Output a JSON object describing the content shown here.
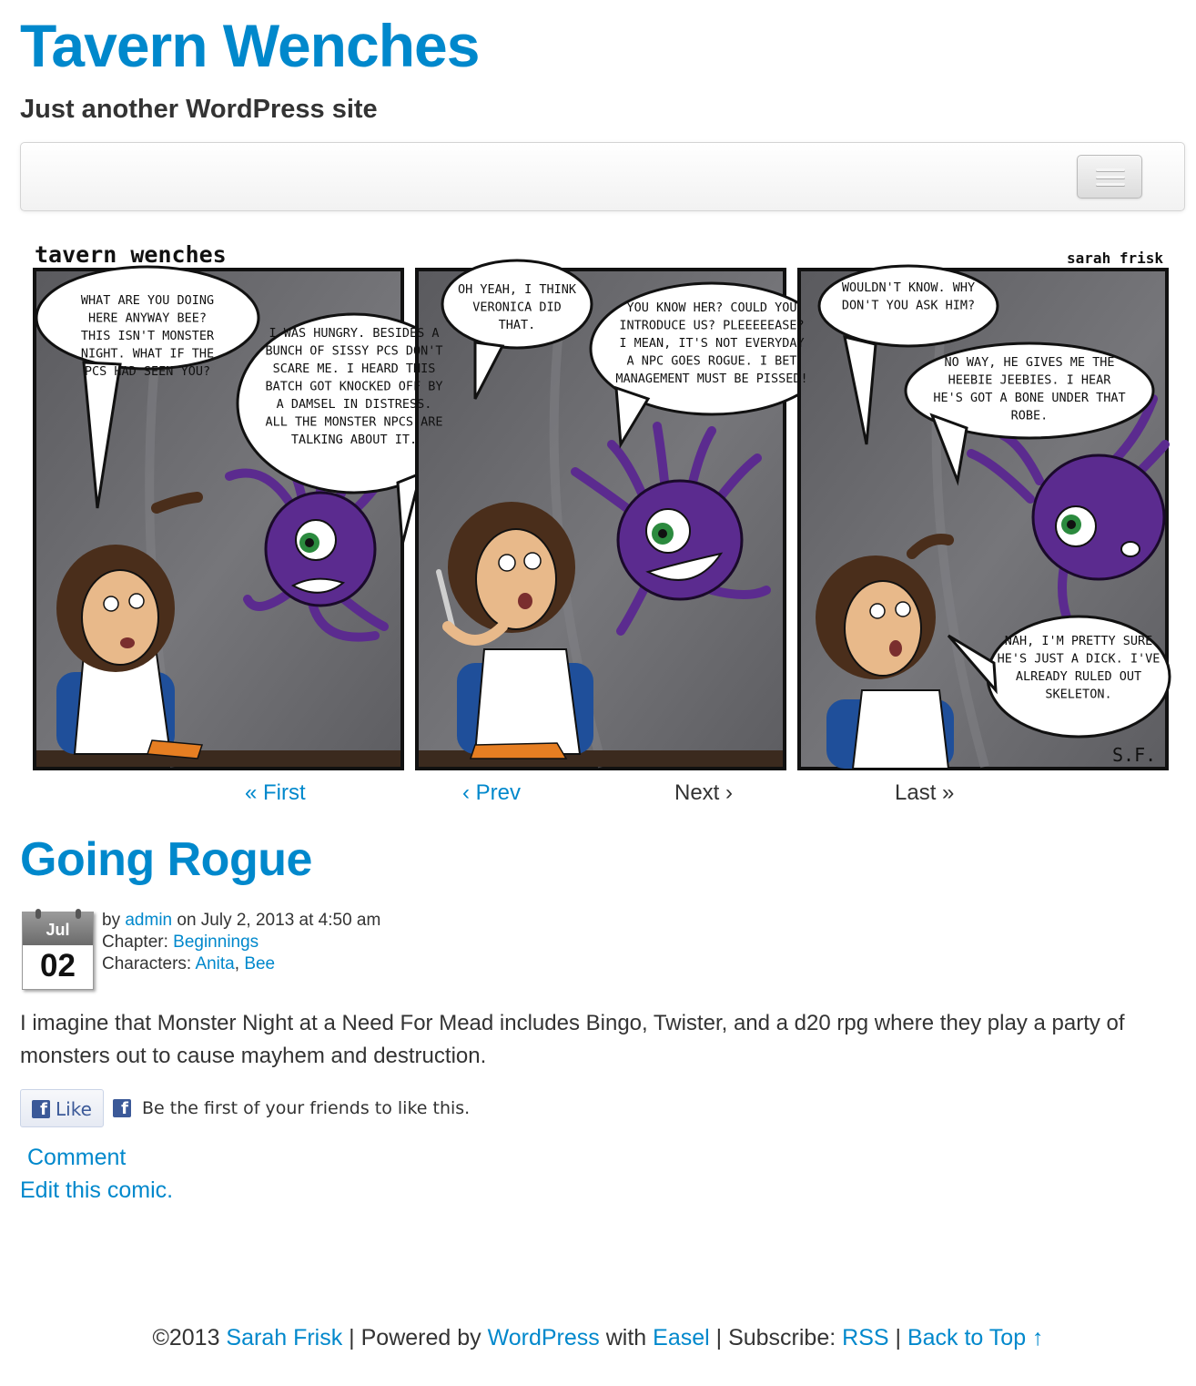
{
  "site": {
    "title": "Tavern Wenches",
    "description": "Just another WordPress site"
  },
  "comic": {
    "header_title": "tavern wenches",
    "artist": "sarah frisk",
    "signature": "S.F.",
    "panels": [
      {
        "bubbles": [
          "WHAT ARE YOU DOING HERE ANYWAY BEE? THIS ISN'T MONSTER NIGHT. WHAT IF THE PCS HAD SEEN YOU?",
          "I WAS HUNGRY. BESIDES A BUNCH OF SISSY PCS DON'T SCARE ME. I HEARD THIS BATCH GOT KNOCKED OFF BY A DAMSEL IN DISTRESS. ALL THE MONSTER NPCS ARE TALKING ABOUT IT."
        ]
      },
      {
        "bubbles": [
          "OH YEAH, I THINK VERONICA DID THAT.",
          "YOU KNOW HER? COULD YOU INTRODUCE US? PLEEEEEASE? I MEAN, IT'S NOT EVERYDAY A NPC GOES ROGUE. I BET MANAGEMENT MUST BE PISSED!"
        ]
      },
      {
        "bubbles": [
          "WOULDN'T KNOW. WHY DON'T YOU ASK HIM?",
          "NO WAY, HE GIVES ME THE HEEBIE JEEBIES. I HEAR HE'S GOT A BONE UNDER THAT ROBE.",
          "NAH, I'M PRETTY SURE HE'S JUST A DICK. I'VE ALREADY RULED OUT SKELETON."
        ]
      }
    ],
    "colors": {
      "background": "#5f5f63",
      "border": "#111111",
      "beholder": "#5b2b8f",
      "skin": "#e8b98a",
      "hair": "#4a2e1b",
      "apron": "#ffffff",
      "dress": "#1f4f9a",
      "carrot": "#e67e22"
    }
  },
  "comic_nav": {
    "first": "« First",
    "prev": "‹ Prev",
    "next": "Next ›",
    "last": "Last »"
  },
  "post": {
    "title": "Going Rogue",
    "date_month": "Jul",
    "date_day": "02",
    "by_prefix": "by ",
    "author": "admin",
    "on_text": " on July 2, 2013 at 4:50 am",
    "chapter_label": "Chapter: ",
    "chapter": "Beginnings",
    "characters_label": "Characters: ",
    "character_1": "Anita",
    "separator": ", ",
    "character_2": "Bee",
    "body": "I imagine that Monster Night at a Need For Mead includes Bingo, Twister, and a d20 rpg where they play a party of monsters out to cause mayhem and destruction.",
    "like_label": "Like",
    "like_text": "Be the first of your friends to like this.",
    "comment_link": "Comment",
    "edit_link": "Edit this comic."
  },
  "footer": {
    "copyright": "©2013 ",
    "author_link": "Sarah Frisk",
    "powered_sep": " | Powered by ",
    "wordpress": "WordPress",
    "with": " with ",
    "easel": "Easel",
    "subscribe_sep": " | Subscribe: ",
    "rss": "RSS",
    "pipe": " | ",
    "back_to_top": "Back to Top ↑"
  },
  "colors": {
    "link": "#0088cc",
    "text": "#333333",
    "facebook": "#3b5998"
  },
  "icons": {
    "menu": "hamburger-icon",
    "calendar": "calendar-icon",
    "facebook": "facebook-icon"
  }
}
